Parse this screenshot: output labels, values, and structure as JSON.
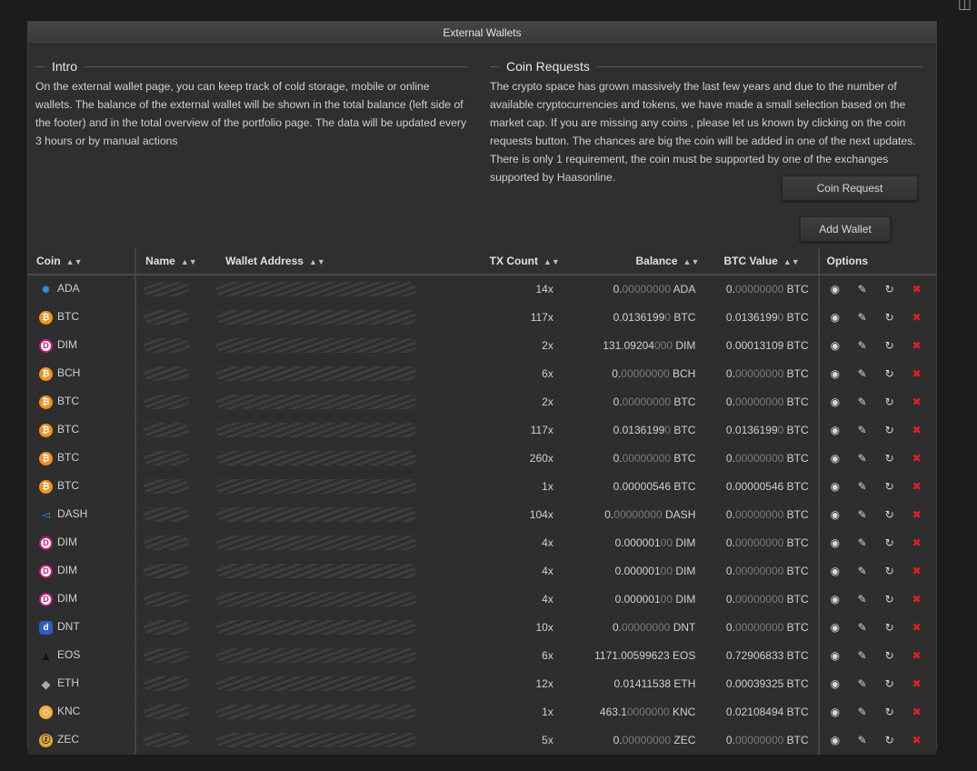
{
  "corner_icon": "map-icon",
  "panel": {
    "title": "External Wallets"
  },
  "intro": {
    "title": "Intro",
    "text": "On the external wallet page, you can keep track of cold storage, mobile or online wallets. The balance of the external wallet will be shown in the total balance (left side of the footer) and in the total overview of the portfolio page. The data will be updated every 3 hours or by manual actions"
  },
  "coin_requests": {
    "title": "Coin Requests",
    "text": "The crypto space has grown massively the last few years and due to the number of available cryptocurrencies and tokens, we have made a small selection based on the market cap. If you are missing any coins , please let us known by clicking on the coin requests button. The chances are big the coin will be added in one of the next updates. There is only 1 requirement, the coin must be supported by one of the exchanges supported by Haasonline."
  },
  "buttons": {
    "coin_request": "Coin Request",
    "add_wallet": "Add Wallet"
  },
  "table": {
    "headers": {
      "coin": "Coin",
      "name": "Name",
      "wallet_address": "Wallet Address",
      "tx_count": "TX Count",
      "balance": "Balance",
      "btc_value": "BTC Value",
      "options": "Options"
    },
    "sort_icon": "sort-icon",
    "option_icons": [
      "view-icon",
      "edit-icon",
      "refresh-icon",
      "delete-icon"
    ],
    "rows": [
      {
        "coin": "ADA",
        "icon": "ada-icon",
        "tx": "14x",
        "bal_main": "0.",
        "bal_dim": "00000000",
        "bal_rest": "",
        "bal_unit": "ADA",
        "btc_main": "0.",
        "btc_dim": "00000000",
        "btc_rest": ""
      },
      {
        "coin": "BTC",
        "icon": "btc-icon",
        "tx": "117x",
        "bal_main": "0.0136199",
        "bal_dim": "0",
        "bal_rest": "",
        "bal_unit": "BTC",
        "btc_main": "0.0136199",
        "btc_dim": "0",
        "btc_rest": ""
      },
      {
        "coin": "DIM",
        "icon": "dim-icon",
        "tx": "2x",
        "bal_main": "131.09204",
        "bal_dim": "000",
        "bal_rest": "",
        "bal_unit": "DIM",
        "btc_main": "0.00013109",
        "btc_dim": "",
        "btc_rest": ""
      },
      {
        "coin": "BCH",
        "icon": "bch-icon",
        "tx": "6x",
        "bal_main": "0.",
        "bal_dim": "00000000",
        "bal_rest": "",
        "bal_unit": "BCH",
        "btc_main": "0.",
        "btc_dim": "00000000",
        "btc_rest": ""
      },
      {
        "coin": "BTC",
        "icon": "btc-icon",
        "tx": "2x",
        "bal_main": "0.",
        "bal_dim": "00000000",
        "bal_rest": "",
        "bal_unit": "BTC",
        "btc_main": "0.",
        "btc_dim": "00000000",
        "btc_rest": ""
      },
      {
        "coin": "BTC",
        "icon": "btc-icon",
        "tx": "117x",
        "bal_main": "0.0136199",
        "bal_dim": "0",
        "bal_rest": "",
        "bal_unit": "BTC",
        "btc_main": "0.0136199",
        "btc_dim": "0",
        "btc_rest": ""
      },
      {
        "coin": "BTC",
        "icon": "btc-icon",
        "tx": "260x",
        "bal_main": "0.",
        "bal_dim": "00000000",
        "bal_rest": "",
        "bal_unit": "BTC",
        "btc_main": "0.",
        "btc_dim": "00000000",
        "btc_rest": ""
      },
      {
        "coin": "BTC",
        "icon": "btc-icon",
        "tx": "1x",
        "bal_main": "0.00000546",
        "bal_dim": "",
        "bal_rest": "",
        "bal_unit": "BTC",
        "btc_main": "0.00000546",
        "btc_dim": "",
        "btc_rest": ""
      },
      {
        "coin": "DASH",
        "icon": "dash-icon",
        "tx": "104x",
        "bal_main": "0.",
        "bal_dim": "00000000",
        "bal_rest": "",
        "bal_unit": "DASH",
        "btc_main": "0.",
        "btc_dim": "00000000",
        "btc_rest": ""
      },
      {
        "coin": "DIM",
        "icon": "dim-icon",
        "tx": "4x",
        "bal_main": "0.000001",
        "bal_dim": "00",
        "bal_rest": "",
        "bal_unit": "DIM",
        "btc_main": "0.",
        "btc_dim": "00000000",
        "btc_rest": ""
      },
      {
        "coin": "DIM",
        "icon": "dim-icon",
        "tx": "4x",
        "bal_main": "0.000001",
        "bal_dim": "00",
        "bal_rest": "",
        "bal_unit": "DIM",
        "btc_main": "0.",
        "btc_dim": "00000000",
        "btc_rest": ""
      },
      {
        "coin": "DIM",
        "icon": "dim-icon",
        "tx": "4x",
        "bal_main": "0.000001",
        "bal_dim": "00",
        "bal_rest": "",
        "bal_unit": "DIM",
        "btc_main": "0.",
        "btc_dim": "00000000",
        "btc_rest": ""
      },
      {
        "coin": "DNT",
        "icon": "dnt-icon",
        "tx": "10x",
        "bal_main": "0.",
        "bal_dim": "00000000",
        "bal_rest": "",
        "bal_unit": "DNT",
        "btc_main": "0.",
        "btc_dim": "00000000",
        "btc_rest": ""
      },
      {
        "coin": "EOS",
        "icon": "eos-icon",
        "tx": "6x",
        "bal_main": "1171.00599623",
        "bal_dim": "",
        "bal_rest": "",
        "bal_unit": "EOS",
        "btc_main": "0.72906833",
        "btc_dim": "",
        "btc_rest": ""
      },
      {
        "coin": "ETH",
        "icon": "eth-icon",
        "tx": "12x",
        "bal_main": "0.01411538",
        "bal_dim": "",
        "bal_rest": "",
        "bal_unit": "ETH",
        "btc_main": "0.00039325",
        "btc_dim": "",
        "btc_rest": ""
      },
      {
        "coin": "KNC",
        "icon": "knc-icon",
        "tx": "1x",
        "bal_main": "463.1",
        "bal_dim": "0000000",
        "bal_rest": "",
        "bal_unit": "KNC",
        "btc_main": "0.02108494",
        "btc_dim": "",
        "btc_rest": ""
      },
      {
        "coin": "ZEC",
        "icon": "zec-icon",
        "tx": "5x",
        "bal_main": "0.",
        "bal_dim": "00000000",
        "bal_rest": "",
        "bal_unit": "ZEC",
        "btc_main": "0.",
        "btc_dim": "00000000",
        "btc_rest": ""
      }
    ]
  },
  "btc_unit": "BTC",
  "colors": {
    "background": "#1c1c1c",
    "panel": "#2f2f2f",
    "delete": "#e02020",
    "bitcoin": "#f2921e"
  }
}
